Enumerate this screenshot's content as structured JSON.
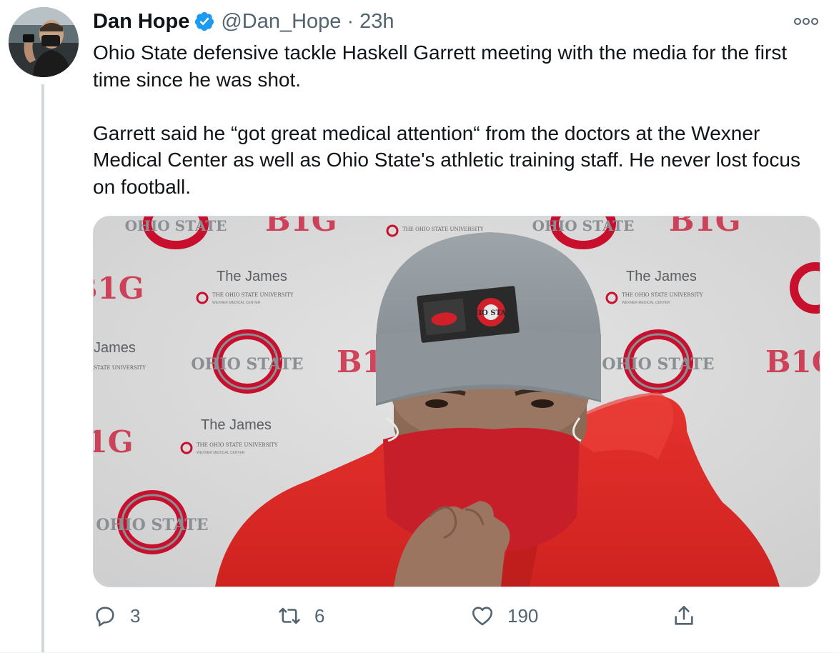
{
  "author": {
    "name": "Dan Hope",
    "handle": "@Dan_Hope",
    "separator": "·",
    "time": "23h",
    "verified_icon": "verified-badge-icon"
  },
  "tweet": {
    "paragraph_1": "Ohio State defensive tackle Haskell Garrett meeting with the media for the first time since he was shot.",
    "paragraph_2": "Garrett said he “got great medical attention“ from the doctors at the Wexner Medical Center as well as Ohio State's athletic training staff. He never lost focus on football."
  },
  "media": {
    "backdrop_text": {
      "the_james": "The James",
      "university": "THE OHIO STATE UNIVERSITY",
      "medical": "WEXNER MEDICAL CENTER",
      "ohio_state": "OHIO STATE",
      "big": "B1G",
      "james_short": "James",
      "university_short": "STATE UNIVERSITY"
    },
    "beanie_label": "OHIO STATE"
  },
  "actions": {
    "reply_count": "3",
    "retweet_count": "6",
    "like_count": "190",
    "icons": [
      "reply-icon",
      "retweet-icon",
      "like-icon",
      "share-icon"
    ]
  },
  "colors": {
    "accent": "#1d9bf0",
    "muted": "#536471",
    "scarlet": "#c8102e",
    "gray": "#8a8f93"
  }
}
